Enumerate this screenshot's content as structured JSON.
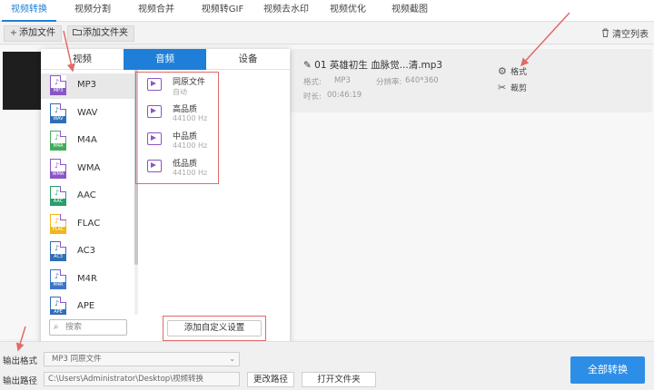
{
  "nav": {
    "tabs": [
      {
        "label": "视频转换",
        "active": true
      },
      {
        "label": "视频分割"
      },
      {
        "label": "视频合并"
      },
      {
        "label": "视频转GIF"
      },
      {
        "label": "视频去水印"
      },
      {
        "label": "视频优化"
      },
      {
        "label": "视频截图"
      }
    ]
  },
  "toolbar": {
    "add_file": "添加文件",
    "add_folder": "添加文件夹",
    "clear_list": "清空列表"
  },
  "file": {
    "name": "01 英雄初生 血脉觉...清.mp3",
    "format_label": "格式:",
    "format_value": "MP3",
    "resolution_label": "分辨率:",
    "resolution_value": "640*360",
    "duration_label": "时长:",
    "duration_value": "00:46:19",
    "format_action": "格式",
    "cut_action": "裁剪"
  },
  "popup": {
    "tabs": [
      "视频",
      "音频",
      "设备"
    ],
    "active_tab": 1,
    "formats": [
      {
        "label": "MP3",
        "color": "#8a56c7"
      },
      {
        "label": "WAV",
        "color": "#2f6fb5"
      },
      {
        "label": "M4A",
        "color": "#3fae5b"
      },
      {
        "label": "WMA",
        "color": "#8a56c7"
      },
      {
        "label": "AAC",
        "color": "#2a9d6a"
      },
      {
        "label": "FLAC",
        "color": "#f2b51c"
      },
      {
        "label": "AC3",
        "color": "#2f6fb5"
      },
      {
        "label": "M4R",
        "color": "#3d74c9"
      },
      {
        "label": "APE",
        "color": "#2f6fb5"
      }
    ],
    "qualities": [
      {
        "name": "同原文件",
        "sub": "自动"
      },
      {
        "name": "高品质",
        "sub": "44100 Hz"
      },
      {
        "name": "中品质",
        "sub": "44100 Hz"
      },
      {
        "name": "低品质",
        "sub": "44100 Hz"
      }
    ],
    "search_placeholder": "搜索",
    "custom_button": "添加自定义设置"
  },
  "bottom": {
    "output_format_label": "输出格式",
    "output_format_value": "MP3  同原文件",
    "output_path_label": "输出路径",
    "output_path_value": "C:\\Users\\Administrator\\Desktop\\视频转换",
    "change_path": "更改路径",
    "open_folder": "打开文件夹",
    "convert_all": "全部转换"
  },
  "colors": {
    "accent": "#1f7fd8",
    "annotation": "#e06a6a",
    "audio_icon": "#8a56c7"
  }
}
